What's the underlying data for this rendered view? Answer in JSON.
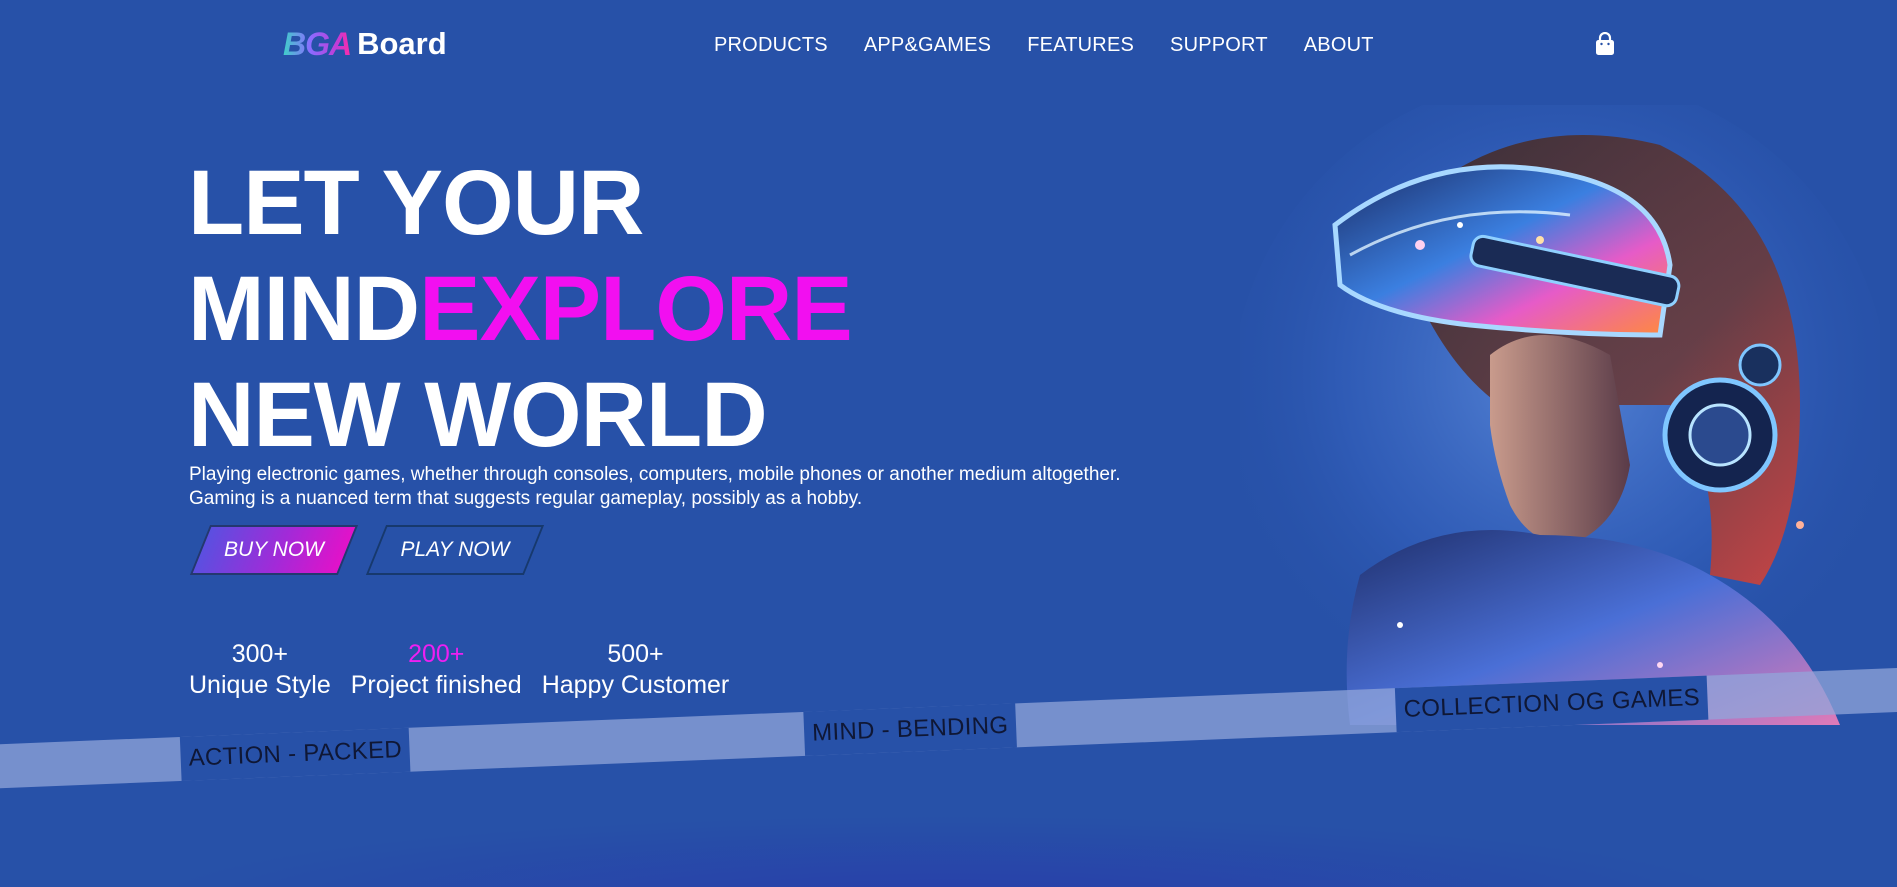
{
  "brand": {
    "mark": "BGA",
    "name": "Board"
  },
  "nav": {
    "items": [
      {
        "label": "PRODUCTS"
      },
      {
        "label": "APP&GAMES"
      },
      {
        "label": "FEATURES"
      },
      {
        "label": "SUPPORT"
      },
      {
        "label": "ABOUT"
      }
    ],
    "cart_icon": "shopping-bag-icon"
  },
  "hero": {
    "line1": "LET YOUR",
    "line2_a": "MIND",
    "line2_b": "EXPLORE",
    "line3": "NEW WORLD",
    "description_1": "Playing electronic games, whether through consoles, computers, mobile phones or another medium altogether.",
    "description_2": "Gaming is a nuanced term that suggests regular gameplay, possibly as a hobby.",
    "buy_label": "BUY NOW",
    "play_label": "PLAY NOW",
    "image": "vr-headset-woman-illustration"
  },
  "stats": [
    {
      "value": "300+",
      "label": "Unique Style"
    },
    {
      "value": "200+",
      "label": "Project finished"
    },
    {
      "value": "500+",
      "label": "Happy Customer"
    }
  ],
  "marquee": [
    "ACTION - PACKED",
    "MIND - BENDING",
    "COLLECTION OG GAMES"
  ],
  "colors": {
    "background": "#2751a8",
    "accent": "#f20ff0",
    "text": "#ffffff",
    "band": "#91a5da"
  }
}
